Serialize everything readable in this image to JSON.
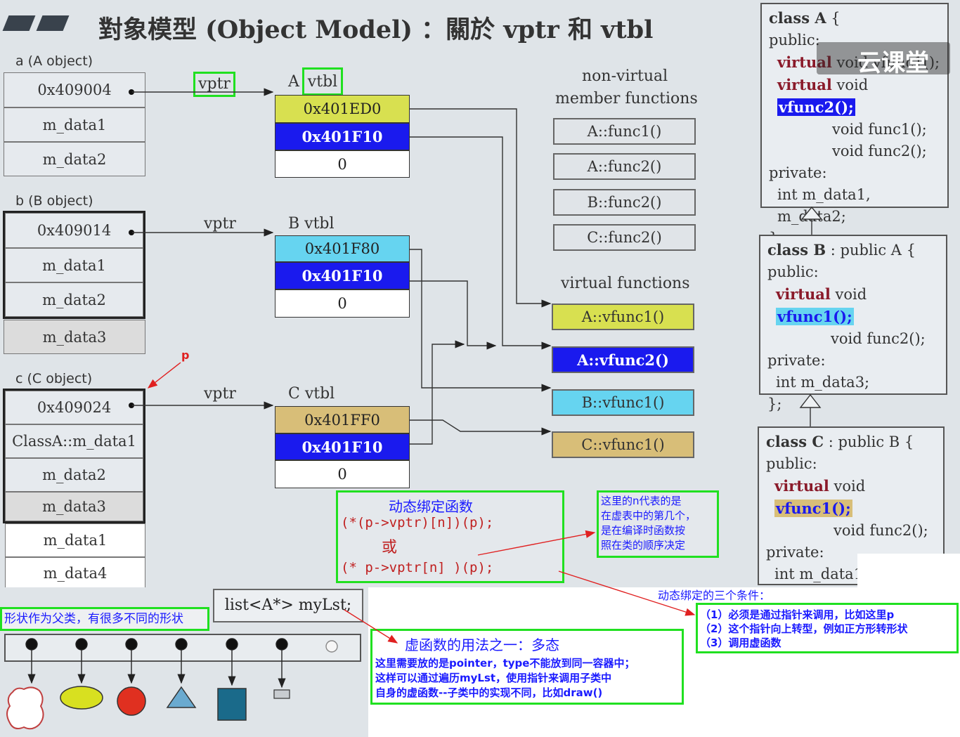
{
  "title": "對象模型 (Object Model) ：關於 vptr 和 vtbl",
  "objects": {
    "a": {
      "label": "a (A object)",
      "cells": [
        "0x409004",
        "m_data1",
        "m_data2"
      ]
    },
    "b": {
      "label": "b (B object)",
      "cells": [
        "0x409014",
        "m_data1",
        "m_data2",
        "m_data3"
      ]
    },
    "c": {
      "label": "c (C object)",
      "cells": [
        "0x409024",
        "ClassA::m_data1",
        "m_data2",
        "m_data3",
        "m_data1",
        "m_data4"
      ]
    }
  },
  "vptr_label": "vptr",
  "p_label": "p",
  "vtables": {
    "a": {
      "prefix": "A",
      "name": "vtbl",
      "entries": [
        "0x401ED0",
        "0x401F10",
        "0"
      ]
    },
    "b": {
      "label": "B vtbl",
      "entries": [
        "0x401F80",
        "0x401F10",
        "0"
      ]
    },
    "c": {
      "label": "C vtbl",
      "entries": [
        "0x401FF0",
        "0x401F10",
        "0"
      ]
    }
  },
  "non_virtual": {
    "heading_line1": "non-virtual",
    "heading_line2": "member functions",
    "items": [
      "A::func1()",
      "A::func2()",
      "B::func2()",
      "C::func2()"
    ]
  },
  "virtual_funcs": {
    "heading": "virtual functions",
    "items": [
      "A::vfunc1()",
      "A::vfunc2()",
      "B::vfunc1()",
      "C::vfunc1()"
    ]
  },
  "classA": {
    "l1a": "class A",
    "l1b": " {",
    "l2": "public:",
    "l3a": "virtual",
    "l3b": " void ",
    "l3c": "vfunc1();",
    "l4a": "virtual",
    "l4b": " void ",
    "l4c": "vfunc2();",
    "l5": "void  func1();",
    "l6": "void  func2();",
    "l7": "private:",
    "l8": "int m_data1, m_data2;",
    "l9": "};",
    "watermark": "云课堂"
  },
  "classB": {
    "l1a": "class B",
    "l1b": " : public A {",
    "l2": "public:",
    "l3a": "virtual",
    "l3b": " void ",
    "l3c": "vfunc1();",
    "l4": "void  func2();",
    "l5": "private:",
    "l6": "int m_data3;",
    "l7": "};"
  },
  "classC": {
    "l1a": "class C",
    "l1b": " : public B {",
    "l2": "public:",
    "l3a": "virtual",
    "l3b": " void ",
    "l3c": "vfunc1();",
    "l4": "void  func2();",
    "l5": "private:",
    "l6": "int m_data1, m_data4;",
    "l7": "};"
  },
  "dynamic_box": {
    "title": "动态绑定函数",
    "code1": "(*(p->vptr)[n])(p);",
    "or": "或",
    "code2": "(* p->vptr[n] )(p);"
  },
  "n_note": [
    "这里的n代表的是",
    "在虚表中的第几个，",
    "是在编译时函数按",
    "照在类的顺序决定"
  ],
  "conditions": {
    "title": "动态绑定的三个条件：",
    "items": [
      "（1）必须是通过指针来调用，比如这里p",
      "（2）这个指针向上转型，例如正方形转形状",
      "（3）调用虚函数"
    ]
  },
  "shape_note": "形状作为父类，有很多不同的形状",
  "list_label": "list<A*> myLst;",
  "usage": {
    "title": "虚函数的用法之一：多态",
    "lines": [
      "这里需要放的是pointer，type不能放到同一容器中；",
      "这样可以通过遍历myLst，使用指针来调用子类中",
      "自身的虚函数--子类中的实现不同，比如draw()"
    ]
  },
  "colors": {
    "yellow": "#d8e050",
    "blue": "#1a1aee",
    "cyan": "#66d4f0",
    "tan": "#d8be78",
    "green": "#20e020",
    "red": "#e02020"
  }
}
